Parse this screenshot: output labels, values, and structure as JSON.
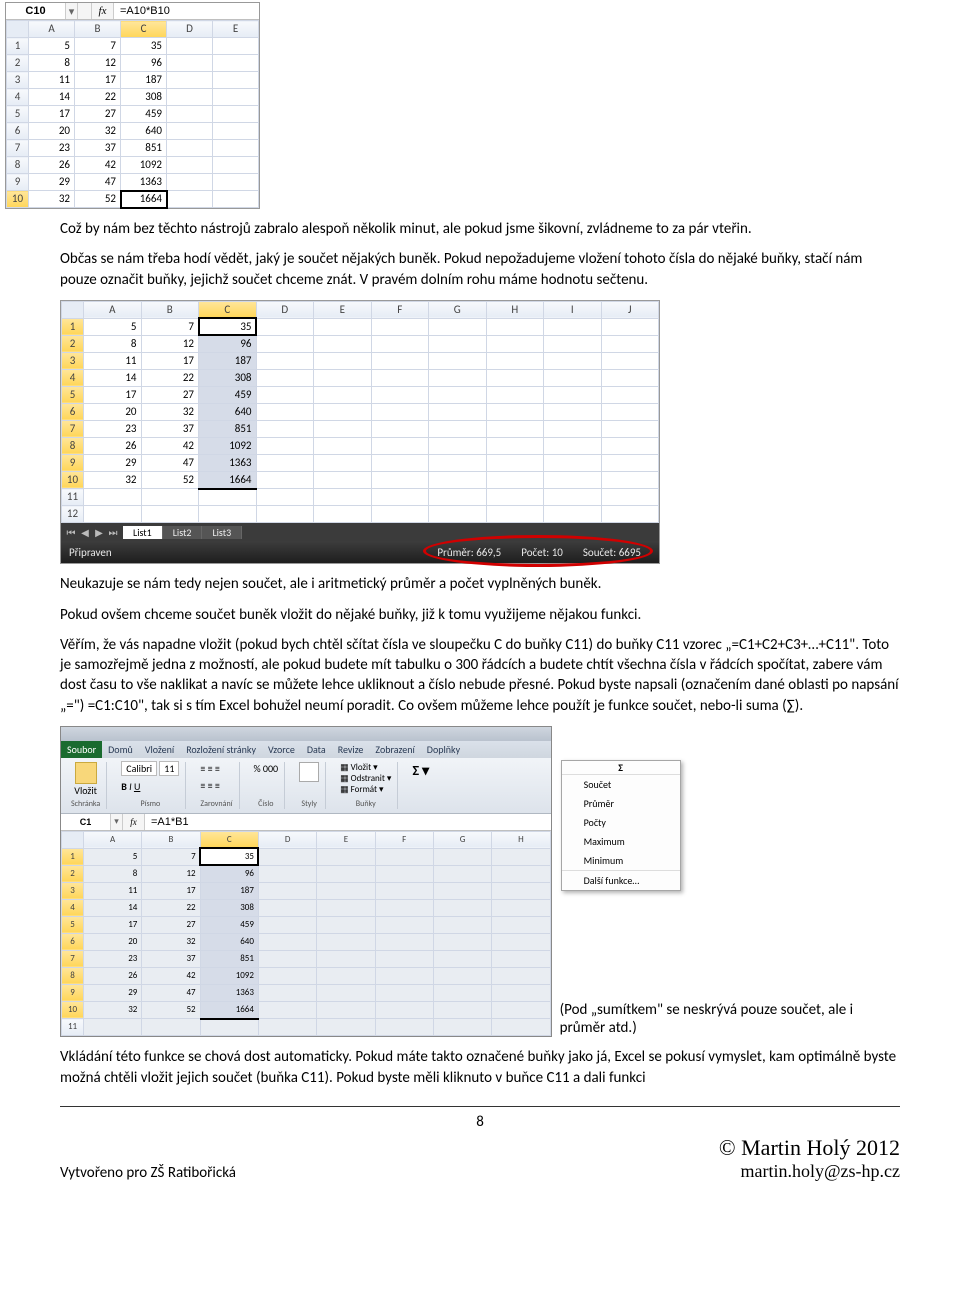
{
  "excel_top": {
    "name_box": "C10",
    "fx_label": "fx",
    "formula": "=A10*B10",
    "columns": [
      "A",
      "B",
      "C",
      "D",
      "E"
    ],
    "rows": [
      {
        "n": "1",
        "A": "5",
        "B": "7",
        "C": "35"
      },
      {
        "n": "2",
        "A": "8",
        "B": "12",
        "C": "96"
      },
      {
        "n": "3",
        "A": "11",
        "B": "17",
        "C": "187"
      },
      {
        "n": "4",
        "A": "14",
        "B": "22",
        "C": "308"
      },
      {
        "n": "5",
        "A": "17",
        "B": "27",
        "C": "459"
      },
      {
        "n": "6",
        "A": "20",
        "B": "32",
        "C": "640"
      },
      {
        "n": "7",
        "A": "23",
        "B": "37",
        "C": "851"
      },
      {
        "n": "8",
        "A": "26",
        "B": "42",
        "C": "1092"
      },
      {
        "n": "9",
        "A": "29",
        "B": "47",
        "C": "1363"
      },
      {
        "n": "10",
        "A": "32",
        "B": "52",
        "C": "1664"
      }
    ],
    "selected_col": "C",
    "active_cell": "C10"
  },
  "para1": "Což by nám bez těchto nástrojů zabralo alespoň několik minut, ale pokud jsme šikovní, zvládneme to za pár vteřin.",
  "para2": "Občas se nám třeba hodí vědět, jaký je součet nějakých buněk. Pokud nepožadujeme vložení tohoto čísla do nějaké buňky, stačí nám pouze označit buňky, jejichž součet chceme znát. V pravém dolním rohu máme hodnotu sečtenu.",
  "excel_mid": {
    "columns": [
      "A",
      "B",
      "C",
      "D",
      "E",
      "F",
      "G",
      "H",
      "I",
      "J"
    ],
    "rows": [
      {
        "n": "1",
        "A": "5",
        "B": "7",
        "C": "35"
      },
      {
        "n": "2",
        "A": "8",
        "B": "12",
        "C": "96"
      },
      {
        "n": "3",
        "A": "11",
        "B": "17",
        "C": "187"
      },
      {
        "n": "4",
        "A": "14",
        "B": "22",
        "C": "308"
      },
      {
        "n": "5",
        "A": "17",
        "B": "27",
        "C": "459"
      },
      {
        "n": "6",
        "A": "20",
        "B": "32",
        "C": "640"
      },
      {
        "n": "7",
        "A": "23",
        "B": "37",
        "C": "851"
      },
      {
        "n": "8",
        "A": "26",
        "B": "42",
        "C": "1092"
      },
      {
        "n": "9",
        "A": "29",
        "B": "47",
        "C": "1363"
      },
      {
        "n": "10",
        "A": "32",
        "B": "52",
        "C": "1664"
      },
      {
        "n": "11"
      },
      {
        "n": "12"
      }
    ],
    "sheet_tabs": [
      "List1",
      "List2",
      "List3"
    ],
    "active_tab": "List1",
    "status_left": "Připraven",
    "status_avg_label": "Průměr:",
    "status_avg_val": "669,5",
    "status_cnt_label": "Počet:",
    "status_cnt_val": "10",
    "status_sum_label": "Součet:",
    "status_sum_val": "6695"
  },
  "para3": "Neukazuje se nám tedy nejen součet, ale i aritmetický průměr a počet vyplněných buněk.",
  "para4": "Pokud ovšem chceme součet buněk vložit do nějaké buňky, již k tomu využijeme nějakou funkci.",
  "para5": "Věřím, že vás napadne vložit (pokud bych chtěl sčítat čísla ve sloupečku C do buňky C11) do buňky C11 vzorec „=C1+C2+C3+…+C11\". Toto je samozřejmě jedna z možností, ale pokud budete mít tabulku o 300 řádcích a budete chtít všechna čísla v řádcích spočítat, zabere vám dost času to vše naklikat a navíc se můžete lehce ukliknout a číslo nebude přesné. Pokud byste napsali (označením dané oblasti po napsání „=\") =C1:C10\", tak si s tím Excel bohužel neumí poradit. Co ovšem můžeme lehce použít je funkce součet, nebo-li suma (∑).",
  "excel_small": {
    "ribbon_tabs": [
      "Soubor",
      "Domů",
      "Vložení",
      "Rozložení stránky",
      "Vzorce",
      "Data",
      "Revize",
      "Zobrazení",
      "Doplňky"
    ],
    "groups": {
      "clipboard": "Schránka",
      "paste": "Vložit",
      "font": "Písmo",
      "align": "Zarovnání",
      "number": "Číslo",
      "styles": "Styly",
      "cells": "Buňky",
      "insert": "Vložit",
      "delete": "Odstranit",
      "format": "Formát"
    },
    "font_name": "Calibri",
    "font_size": "11",
    "name_box": "C1",
    "fx_label": "fx",
    "formula": "=A1*B1",
    "columns": [
      "A",
      "B",
      "C",
      "D",
      "E",
      "F",
      "G",
      "H"
    ],
    "rows": [
      {
        "n": "1",
        "A": "5",
        "B": "7",
        "C": "35"
      },
      {
        "n": "2",
        "A": "8",
        "B": "12",
        "C": "96"
      },
      {
        "n": "3",
        "A": "11",
        "B": "17",
        "C": "187"
      },
      {
        "n": "4",
        "A": "14",
        "B": "22",
        "C": "308"
      },
      {
        "n": "5",
        "A": "17",
        "B": "27",
        "C": "459"
      },
      {
        "n": "6",
        "A": "20",
        "B": "32",
        "C": "640"
      },
      {
        "n": "7",
        "A": "23",
        "B": "37",
        "C": "851"
      },
      {
        "n": "8",
        "A": "26",
        "B": "42",
        "C": "1092"
      },
      {
        "n": "9",
        "A": "29",
        "B": "47",
        "C": "1363"
      },
      {
        "n": "10",
        "A": "32",
        "B": "52",
        "C": "1664"
      },
      {
        "n": "11"
      }
    ],
    "autosum_sigma": "Σ",
    "autosum_menu": [
      "Součet",
      "Průměr",
      "Počty",
      "Maximum",
      "Minimum",
      "Další funkce…"
    ]
  },
  "inline_note": "(Pod „sumítkem\" se neskrývá pouze součet, ale i průměr atd.)",
  "para6": "Vkládání této funkce se chová dost automaticky. Pokud máte takto označené buňky jako já, Excel se pokusí vymyslet, kam optimálně byste možná chtěli vložit jejich součet (buňka C11). Pokud byste měli kliknuto v buňce C11 a dali funkci",
  "footer": {
    "page_no": "8",
    "left": "Vytvořeno pro ZŠ Ratibořická",
    "right_line1": "© Martin Holý 2012",
    "right_line2": "martin.holy@zs-hp.cz"
  }
}
